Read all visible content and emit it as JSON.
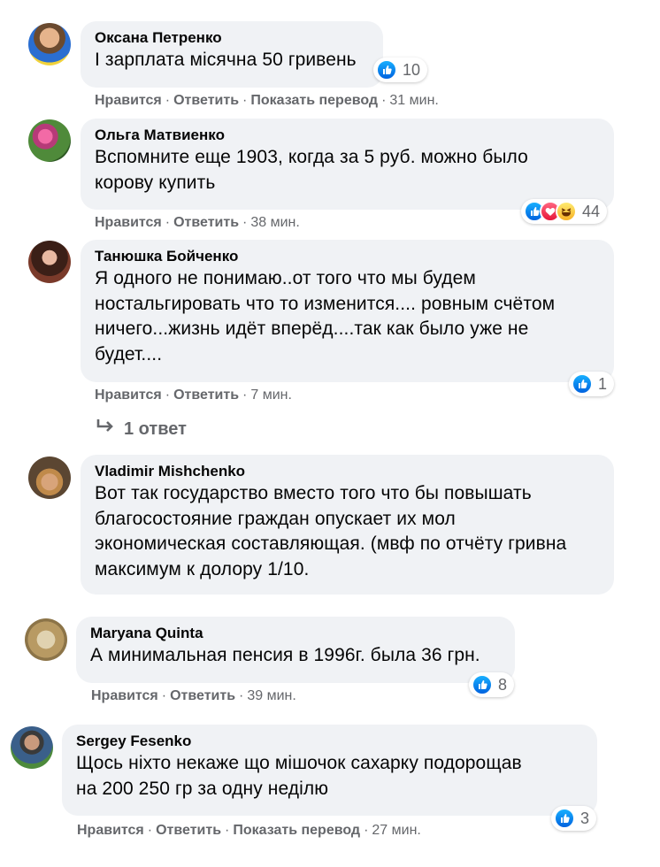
{
  "labels": {
    "like": "Нравится",
    "reply": "Ответить",
    "translate": "Показать перевод",
    "separator": "·"
  },
  "comments": [
    {
      "author": "Оксана Петренко",
      "lines": [
        "І зарплата місячна 50 гривень"
      ],
      "time": "31 мин.",
      "reaction_count": "10",
      "show_translate": true
    },
    {
      "author": "Ольга Матвиенко",
      "lines": [
        "Вспомните еще 1903, когда за 5 руб. можно было",
        "корову купить"
      ],
      "time": "38 мин.",
      "reaction_count": "44",
      "show_translate": false
    },
    {
      "author": "Танюшка Бойченко",
      "lines": [
        "Я одного не понимаю..от того что мы будем",
        "ностальгировать что то изменится.... ровным счётом",
        "ничего...жизнь идёт вперёд....так как было уже не",
        "будет...."
      ],
      "time": "7 мин.",
      "reaction_count": "1",
      "show_translate": false
    },
    {
      "author": "Vladimir Mishchenko",
      "lines": [
        "Вот так государство вместо того что бы повышать",
        "благосостояние граждан опускает их мол",
        "экономическая составляющая. (мвф по отчёту гривна",
        "максимум к долору 1/10."
      ],
      "show_translate": false
    },
    {
      "author": "Maryana Quinta",
      "lines": [
        "А минимальная пенсия в 1996г. была 36 грн."
      ],
      "time": "39 мин.",
      "reaction_count": "8",
      "show_translate": false
    },
    {
      "author": "Sergey Fesenko",
      "lines": [
        "Щось ніхто некаже що мішочок сахарку подорощав",
        "на 200 250 гр за одну неділю"
      ],
      "time": "27 мин.",
      "reaction_count": "3",
      "show_translate": true
    }
  ],
  "replies_link": {
    "label": "1 ответ"
  },
  "colors": {
    "bubble": "#f0f2f5",
    "muted": "#65676b",
    "like_blue": "#1877f2"
  }
}
